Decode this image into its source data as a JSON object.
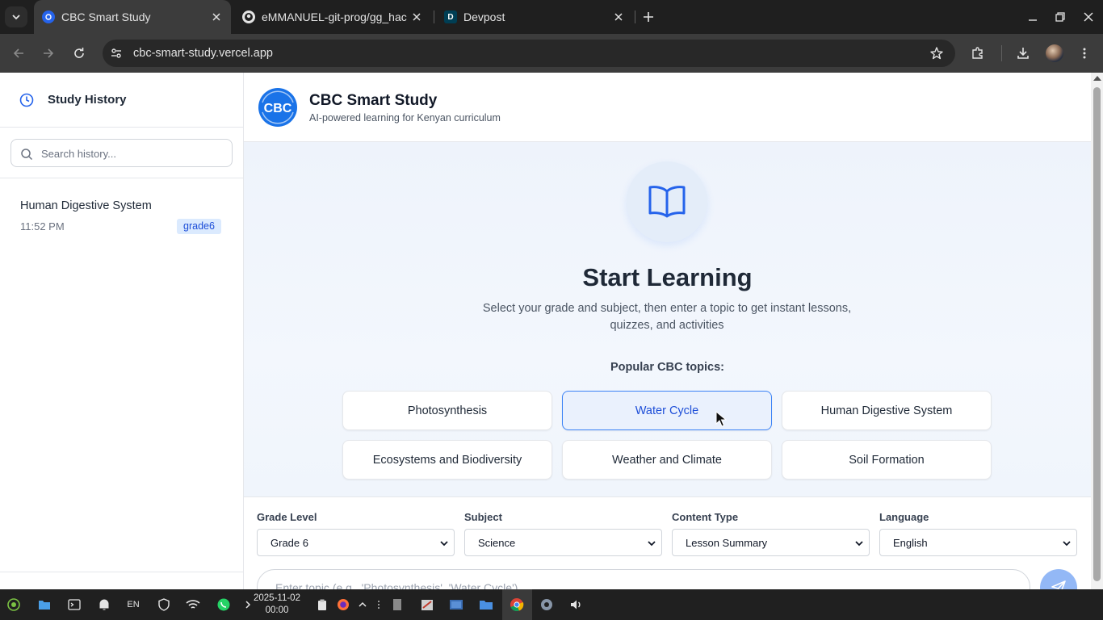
{
  "browser": {
    "tabs": [
      {
        "title": "CBC Smart Study",
        "active": true
      },
      {
        "title": "eMMANUEL-git-prog/gg_hac",
        "active": false
      },
      {
        "title": "Devpost",
        "active": false
      }
    ],
    "devpost_favicon_letter": "D",
    "url": "cbc-smart-study.vercel.app"
  },
  "sidebar": {
    "title": "Study History",
    "search_placeholder": "Search history...",
    "history": [
      {
        "title": "Human Digestive System",
        "time": "11:52 PM",
        "badge": "grade6"
      }
    ]
  },
  "app": {
    "title": "CBC Smart Study",
    "subtitle": "AI-powered learning for Kenyan curriculum",
    "logo_text": "CBC",
    "accent_color": "#2563eb"
  },
  "hero": {
    "title": "Start Learning",
    "description": "Select your grade and subject, then enter a topic to get instant lessons, quizzes, and activities",
    "popular_label": "Popular CBC topics:",
    "topics": [
      "Photosynthesis",
      "Water Cycle",
      "Human Digestive System",
      "Ecosystems and Biodiversity",
      "Weather and Climate",
      "Soil Formation"
    ],
    "hovered_topic": "Water Cycle"
  },
  "controls": {
    "grade": {
      "label": "Grade Level",
      "value": "Grade 6"
    },
    "subject": {
      "label": "Subject",
      "value": "Science"
    },
    "content_type": {
      "label": "Content Type",
      "value": "Lesson Summary"
    },
    "language": {
      "label": "Language",
      "value": "English"
    },
    "topic_placeholder": "Enter topic (e.g., 'Photosynthesis', 'Water Cycle')"
  },
  "taskbar": {
    "date": "2025-11-02",
    "time": "00:00",
    "keyboard_layout": "EN"
  }
}
